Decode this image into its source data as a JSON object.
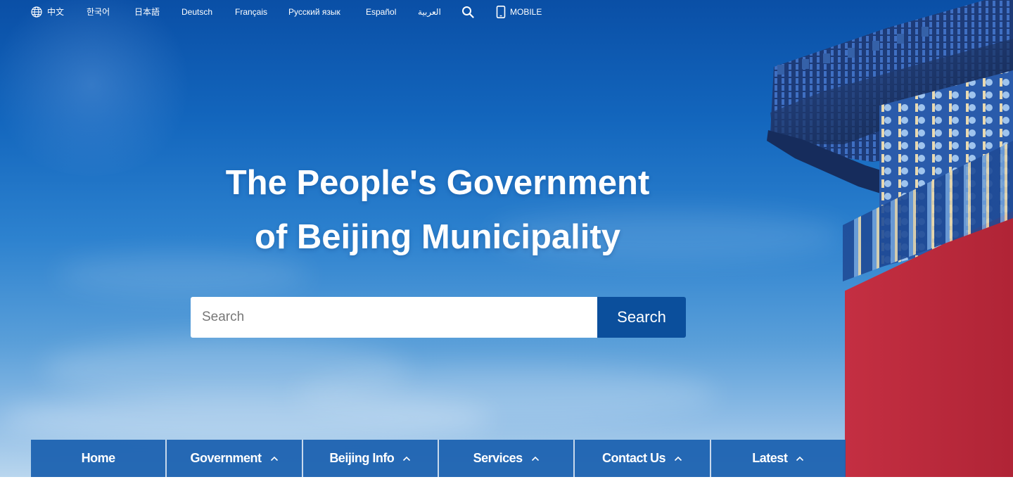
{
  "topbar": {
    "languages": [
      "中文",
      "한국어",
      "日本語",
      "Deutsch",
      "Français",
      "Русский язык",
      "Español",
      "العربية"
    ],
    "mobile_label": "MOBILE"
  },
  "hero": {
    "title_line1": "The People's Government",
    "title_line2": "of Beijing Municipality"
  },
  "search": {
    "placeholder": "Search",
    "button_label": "Search"
  },
  "nav": {
    "items": [
      {
        "label": "Home",
        "has_submenu": false
      },
      {
        "label": "Government",
        "has_submenu": true
      },
      {
        "label": "Beijing Info",
        "has_submenu": true
      },
      {
        "label": "Services",
        "has_submenu": true
      },
      {
        "label": "Contact Us",
        "has_submenu": true
      },
      {
        "label": "Latest",
        "has_submenu": true
      }
    ]
  },
  "colors": {
    "nav_bg": "#195faf",
    "search_button_bg": "#0b4f9c",
    "wall_red": "#b9283c"
  },
  "icons": [
    "globe-icon",
    "search-icon",
    "mobile-phone-icon",
    "chevron-up-icon"
  ]
}
